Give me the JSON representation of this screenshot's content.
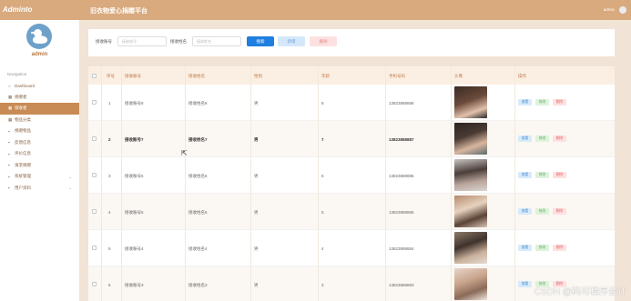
{
  "brand": {
    "name": "Adminto"
  },
  "user": {
    "name": "admin"
  },
  "nav_label": "Navigation",
  "menu": [
    {
      "label": "Dashboard",
      "icon": "home-icon",
      "glyph": "⌂",
      "active": false,
      "expandable": false
    },
    {
      "label": "捐赠者",
      "icon": "list-icon",
      "glyph": "▦",
      "active": false,
      "expandable": false
    },
    {
      "label": "接收者",
      "icon": "list-icon",
      "glyph": "▦",
      "active": true,
      "expandable": false
    },
    {
      "label": "物品分类",
      "icon": "list-icon",
      "glyph": "▦",
      "active": false,
      "expandable": false
    },
    {
      "label": "捐赠物品",
      "icon": "grid-icon",
      "glyph": "▪",
      "active": false,
      "expandable": false
    },
    {
      "label": "反馈信息",
      "icon": "grid-icon",
      "glyph": "▪",
      "active": false,
      "expandable": false
    },
    {
      "label": "评价信息",
      "icon": "grid-icon",
      "glyph": "▪",
      "active": false,
      "expandable": false
    },
    {
      "label": "请求捐赠",
      "icon": "grid-icon",
      "glyph": "▪",
      "active": false,
      "expandable": false
    },
    {
      "label": "系统管理",
      "icon": "grid-icon",
      "glyph": "▪",
      "active": false,
      "expandable": true
    },
    {
      "label": "用户资料",
      "icon": "grid-icon",
      "glyph": "▪",
      "active": false,
      "expandable": true
    }
  ],
  "header": {
    "title": "旧衣物爱心捐赠平台",
    "user": "admin"
  },
  "search": {
    "account_label": "接收账号",
    "account_placeholder": "接收账号",
    "name_label": "接收姓名",
    "name_placeholder": "接收姓名",
    "search_button": "搜索",
    "add_button": "新增",
    "delete_button": "删除"
  },
  "table": {
    "columns": [
      "序号",
      "接收账号",
      "接收姓名",
      "性别",
      "年龄",
      "手机号码",
      "头像",
      "操作"
    ],
    "rows": [
      {
        "index": "1",
        "account": "接收账号8",
        "name": "接收姓名8",
        "gender": "男",
        "age": "8",
        "phone": "13823888888"
      },
      {
        "index": "2",
        "account": "接收账号7",
        "name": "接收姓名7",
        "gender": "男",
        "age": "7",
        "phone": "13823888887"
      },
      {
        "index": "3",
        "account": "接收账号6",
        "name": "接收姓名6",
        "gender": "男",
        "age": "6",
        "phone": "13823888886"
      },
      {
        "index": "4",
        "account": "接收账号5",
        "name": "接收姓名5",
        "gender": "男",
        "age": "5",
        "phone": "13823888885"
      },
      {
        "index": "5",
        "account": "接收账号4",
        "name": "接收姓名4",
        "gender": "男",
        "age": "4",
        "phone": "13823888884"
      },
      {
        "index": "6",
        "account": "接收账号3",
        "name": "接收姓名3",
        "gender": "男",
        "age": "3",
        "phone": "13823888883"
      }
    ],
    "actions": {
      "view": "查看",
      "edit": "修改",
      "delete": "删除"
    }
  },
  "watermark": "CSDN @码可程序设计",
  "colors": {
    "accent": "#d9aa7e",
    "active_menu": "#c88b55",
    "primary": "#1e7fe0",
    "page_bg": "#f1e4d6"
  }
}
